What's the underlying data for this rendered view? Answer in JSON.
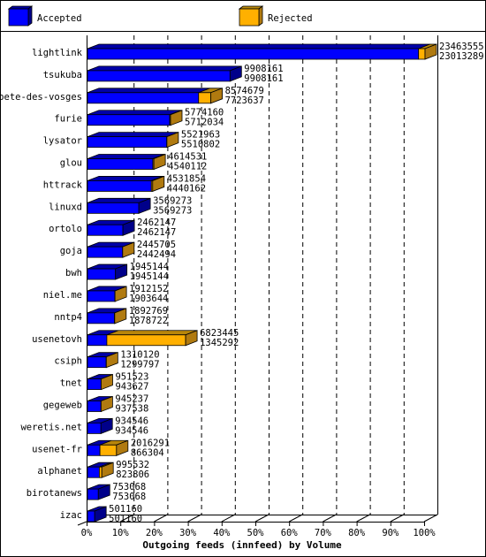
{
  "chart_data": {
    "type": "bar",
    "orientation": "horizontal",
    "stacked": true,
    "style": "3d",
    "title": "",
    "xlabel": "Outgoing feeds (innfeed) by Volume",
    "ylabel": "",
    "xlim": [
      0,
      100
    ],
    "x_ticks": [
      "0%",
      "10%",
      "20%",
      "30%",
      "40%",
      "50%",
      "60%",
      "70%",
      "80%",
      "90%",
      "100%"
    ],
    "grid": true,
    "legend": {
      "placement": "top",
      "entries": [
        {
          "name": "Accepted",
          "color": "#0000ff"
        },
        {
          "name": "Rejected",
          "color": "#ffb000"
        }
      ]
    },
    "categories": [
      "lightlink",
      "tsukuba",
      "bete-des-vosges",
      "furie",
      "lysator",
      "glou",
      "httrack",
      "linuxd",
      "ortolo",
      "goja",
      "bwh",
      "niel.me",
      "nntp4",
      "usenetovh",
      "csiph",
      "tnet",
      "gegeweb",
      "weretis.net",
      "usenet-fr",
      "alphanet",
      "birotanews",
      "izac"
    ],
    "totals": [
      23463555,
      9908161,
      8574679,
      5774160,
      5521963,
      4614531,
      4531854,
      3569273,
      2462147,
      2445705,
      1945144,
      1912152,
      1892769,
      6823445,
      1310120,
      951523,
      945237,
      934546,
      2016291,
      995532,
      753068,
      501160
    ],
    "series": [
      {
        "name": "Accepted",
        "values": [
          23013289,
          9908161,
          7723637,
          5712034,
          5510802,
          4540112,
          4440162,
          3569273,
          2462147,
          2442494,
          1945144,
          1903644,
          1878722,
          1345292,
          1299797,
          943627,
          937538,
          934546,
          866304,
          823806,
          753068,
          501160
        ]
      },
      {
        "name": "Rejected",
        "values": [
          450266,
          0,
          851042,
          62126,
          11161,
          74419,
          91692,
          0,
          0,
          3211,
          0,
          8508,
          14047,
          5478153,
          10323,
          7896,
          7699,
          0,
          1149987,
          171726,
          0,
          0
        ]
      }
    ]
  }
}
